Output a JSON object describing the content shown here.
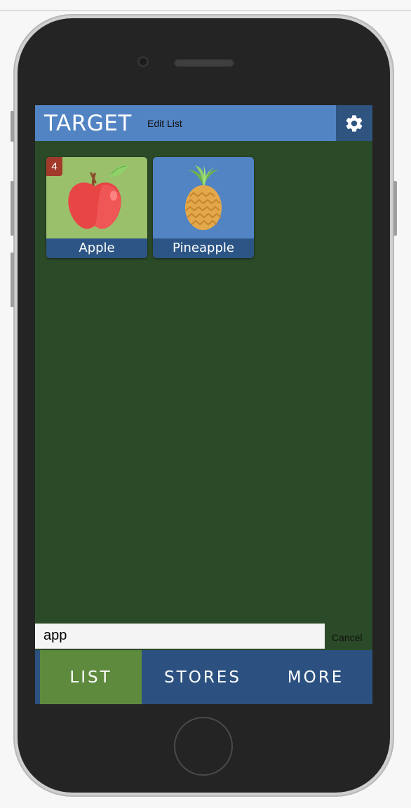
{
  "app": {
    "title": "TARGET",
    "edit_list_label": "Edit List"
  },
  "items": [
    {
      "name": "Apple",
      "badge": "4",
      "tile_color": "#9ac06c",
      "icon": "apple-icon"
    },
    {
      "name": "Pineapple",
      "badge": "",
      "tile_color": "#5284c4",
      "icon": "pineapple-icon"
    }
  ],
  "search": {
    "value": "app",
    "cancel_label": "Cancel"
  },
  "tabs": [
    {
      "label": "LIST",
      "active": true
    },
    {
      "label": "STORES",
      "active": false
    },
    {
      "label": "MORE",
      "active": false
    }
  ],
  "colors": {
    "header": "#5284c4",
    "screen_bg": "#2b4a28",
    "tabbar": "#2c5180",
    "tab_active": "#5e8a3e",
    "badge": "#a23a2c"
  }
}
